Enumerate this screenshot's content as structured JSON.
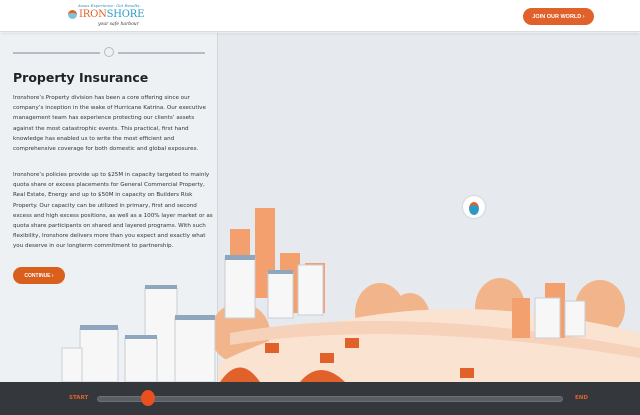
{
  "header": {
    "logo": {
      "tagline": "Asses Experience. Get Results.",
      "brand_a": "IRON",
      "brand_b": "SHORE",
      "slogan": "your safe harbour"
    },
    "join_label": "JOIN OUR WORLD ›"
  },
  "panel": {
    "title": "Property Insurance",
    "paragraphs": [
      "Ironshore’s Property division has been a core offering since our company’s inception in the wake of Hurricane Katrina. Our executive management team has experience protecting our clients’ assets against the most catastrophic events. This practical, first hand knowledge has enabled us to write the most efficient and comprehensive coverage for both domestic and global exposures.",
      "Ironshore’s policies provide up to $25M in capacity targeted to mainly quota share or excess placements for General Commercial Property, Real Estate, Energy and up to $50M in capacity on Builders Risk Property. Our capacity can be utilized in primary, first and second excess and high excess positions, as well as a 100% layer market or as quota share participants on shared and layered programs. With such flexibility, Ironshore delivers more than you expect and exactly what you deserve in our longterm commitment to partnership."
    ],
    "continue_label": "CONTINUE ›"
  },
  "timeline": {
    "start_label": "START",
    "end_label": "END",
    "progress": 0.11
  },
  "colors": {
    "accent": "#e0622a",
    "footer": "#34383c",
    "panel": "#eef1f4"
  }
}
